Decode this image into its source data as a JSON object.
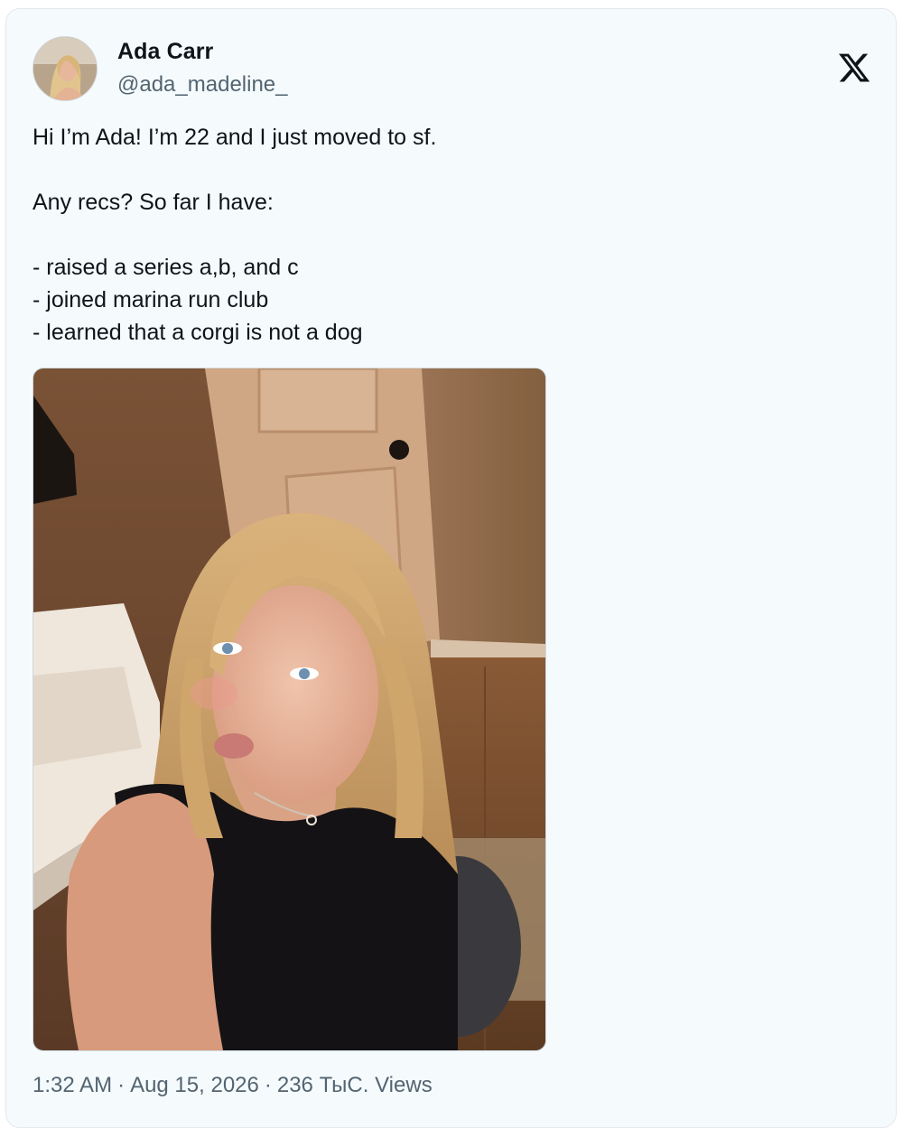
{
  "author": {
    "display_name": "Ada Carr",
    "handle": "@ada_madeline_"
  },
  "brand_icon": "x-logo-icon",
  "tweet": {
    "lines": [
      "Hi I’m Ada! I’m 22 and I just moved to sf.",
      "",
      "Any recs? So far I have:",
      "",
      "- raised a series a,b, and c",
      "- joined marina run club",
      "- learned that a corgi is not a dog"
    ]
  },
  "meta": {
    "time": "1:32 AM",
    "separator": "·",
    "date": "Aug 15, 2026",
    "views_count": "236 ТыС.",
    "views_label": "Views"
  },
  "colors": {
    "card_background": "#f5fbfd",
    "text_primary": "#0f1419",
    "text_secondary": "#536471"
  }
}
